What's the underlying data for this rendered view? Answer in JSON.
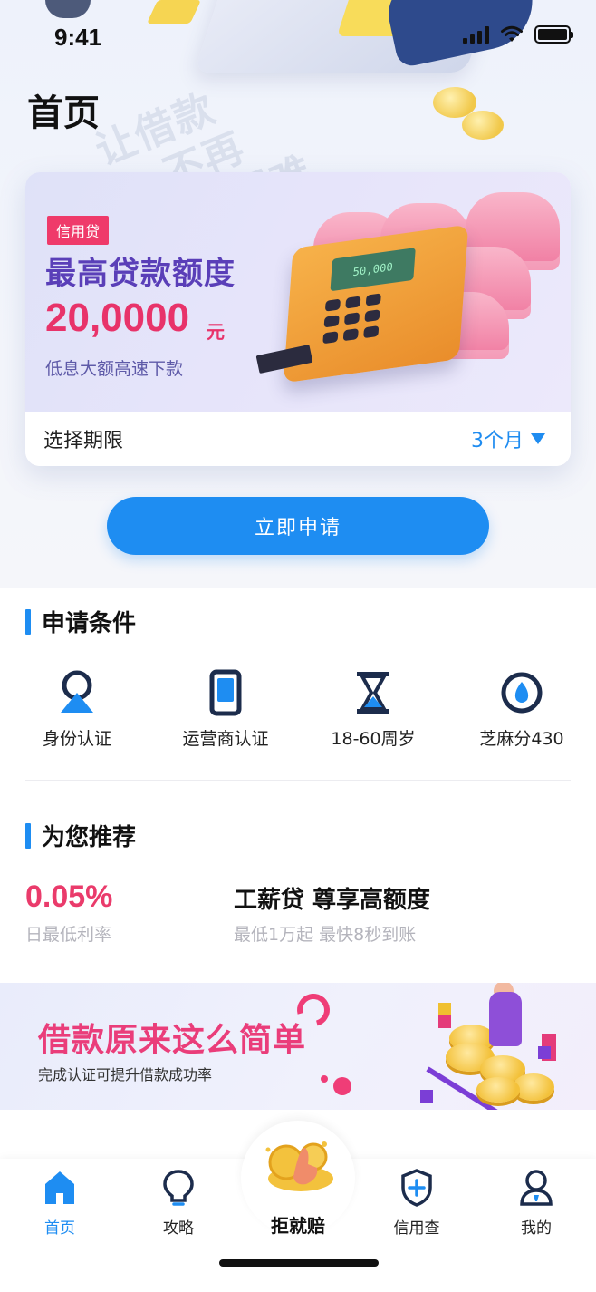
{
  "status_bar": {
    "time": "9:41"
  },
  "header": {
    "title": "首页"
  },
  "hero": {
    "watermark_lines": [
      "让借款",
      "不再",
      "困难"
    ]
  },
  "loan_card": {
    "tag": "信用贷",
    "headline": "最高贷款额度",
    "amount": "20,0000",
    "amount_unit": "元",
    "subtitle": "低息大额高速下款",
    "pos_screen": "50,000",
    "period_label": "选择期限",
    "period_value": "3个月"
  },
  "apply_button": {
    "label": "立即申请"
  },
  "conditions": {
    "title": "申请条件",
    "items": [
      {
        "label": "身份认证",
        "icon": "id-person-icon"
      },
      {
        "label": "运营商认证",
        "icon": "mobile-phone-icon"
      },
      {
        "label": "18-60周岁",
        "icon": "hourglass-icon"
      },
      {
        "label": "芝麻分430",
        "icon": "sesame-score-icon"
      }
    ]
  },
  "recommend": {
    "title": "为您推荐",
    "rate": "0.05%",
    "rate_label": "日最低利率",
    "product_title": "工薪贷 尊享高额度",
    "product_desc": "最低1万起 最快8秒到账"
  },
  "promo": {
    "title": "借款原来这么简单",
    "subtitle": "完成认证可提升借款成功率"
  },
  "tab_bar": {
    "items": [
      {
        "label": "首页",
        "icon": "home-icon",
        "active": true
      },
      {
        "label": "攻略",
        "icon": "lightbulb-icon",
        "active": false
      },
      {
        "label": "拒就赔",
        "icon": "coin-hand-icon",
        "active": false
      },
      {
        "label": "信用查",
        "icon": "shield-plus-icon",
        "active": false
      },
      {
        "label": "我的",
        "icon": "user-icon",
        "active": false
      }
    ]
  },
  "colors": {
    "accent": "#1e8df2",
    "rate_red": "#ea3b6b",
    "headline_purple": "#5a3fb8"
  }
}
